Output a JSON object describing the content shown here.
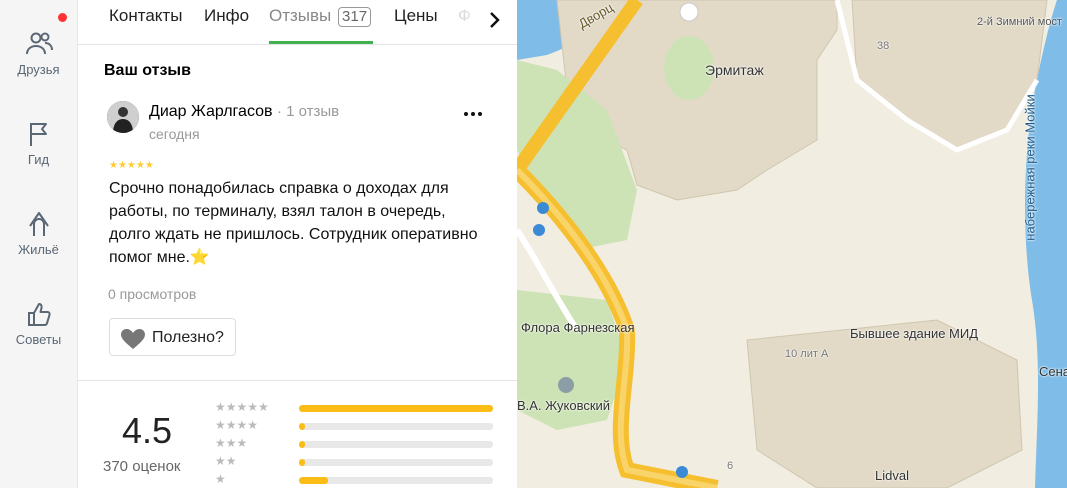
{
  "rail": {
    "items": [
      {
        "label": "Друзья",
        "icon": "friends-icon"
      },
      {
        "label": "Гид",
        "icon": "flag-icon"
      },
      {
        "label": "Жильё",
        "icon": "housing-icon"
      },
      {
        "label": "Советы",
        "icon": "thumbs-up-icon"
      }
    ],
    "notification_color": "#ff3333"
  },
  "tabs": {
    "items": [
      "Контакты",
      "Инфо",
      "Отзывы",
      "Цены",
      "Ф"
    ],
    "reviews_count": "317",
    "active": "Отзывы",
    "accent": "#40b34f"
  },
  "my_review": {
    "title": "Ваш отзыв",
    "author": "Диар Жарлгасов",
    "author_reviews": "· 1 отзыв",
    "date": "сегодня",
    "stars": 5,
    "stars_text": "★★★★★",
    "text": "Срочно понадобилась справка о доходах для работы, по терминалу, взял талон в очередь, долго ждать не пришлось. Сотрудник оперативно помог мне.",
    "emoji": "⭐",
    "views": "0 просмотров",
    "useful_label": "Полезно?"
  },
  "summary": {
    "rating": "4.5",
    "count": "370 оценок",
    "histogram": [
      {
        "stars": 5,
        "stars_text": "★★★★★",
        "fraction": 1.0
      },
      {
        "stars": 4,
        "stars_text": "★★★★",
        "fraction": 0.03
      },
      {
        "stars": 3,
        "stars_text": "★★★",
        "fraction": 0.03
      },
      {
        "stars": 2,
        "stars_text": "★★",
        "fraction": 0.03
      },
      {
        "stars": 1,
        "stars_text": "★",
        "fraction": 0.15
      }
    ],
    "bar_color": "#fbbd16"
  },
  "map": {
    "labels": {
      "hermitage": "Эрмитаж",
      "dvortsovaya": "Дворц",
      "flora": "Флора Фарнезская",
      "zhukovsky": "В.А. Жуковский",
      "mid": "Бывшее здание МИД",
      "house": "10 лит А",
      "moika": "набережная реки Мойки",
      "lidval": "Lidval",
      "num38": "38",
      "num6": "6",
      "zimny": "2-й Зимний мост",
      "sena": "Сена"
    }
  }
}
